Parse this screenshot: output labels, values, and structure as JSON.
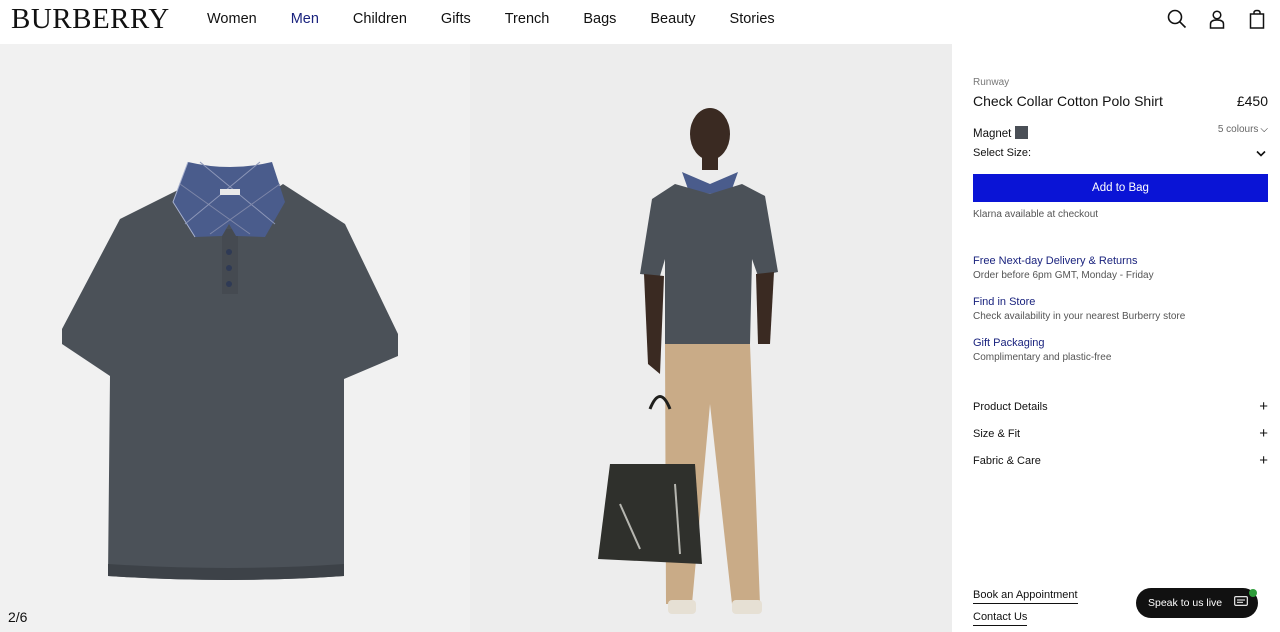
{
  "header": {
    "logo": "BURBERRY",
    "nav": [
      "Women",
      "Men",
      "Children",
      "Gifts",
      "Trench",
      "Bags",
      "Beauty",
      "Stories"
    ],
    "active_nav": "Men",
    "icons": [
      "search-icon",
      "account-icon",
      "bag-icon"
    ]
  },
  "gallery": {
    "counter": "2/6"
  },
  "product": {
    "eyebrow": "Runway",
    "title": "Check Collar Cotton Polo Shirt",
    "price": "£450",
    "colour_name": "Magnet",
    "colour_hex": "#4a4f56",
    "colours_link": "5 colours",
    "size_label": "Select Size:",
    "add_to_bag": "Add to Bag",
    "klarna": "Klarna available at checkout"
  },
  "services": [
    {
      "title": "Free Next-day Delivery & Returns",
      "subtitle": "Order before 6pm GMT, Monday - Friday"
    },
    {
      "title": "Find in Store",
      "subtitle": "Check availability in your nearest Burberry store"
    },
    {
      "title": "Gift Packaging",
      "subtitle": "Complimentary and plastic-free"
    }
  ],
  "accordion": [
    "Product Details",
    "Size & Fit",
    "Fabric & Care"
  ],
  "footer_links": [
    "Book an Appointment",
    "Contact Us"
  ],
  "chat": {
    "label": "Speak to us live"
  },
  "colors": {
    "accent": "#0a14d6",
    "link": "#1a237e"
  }
}
